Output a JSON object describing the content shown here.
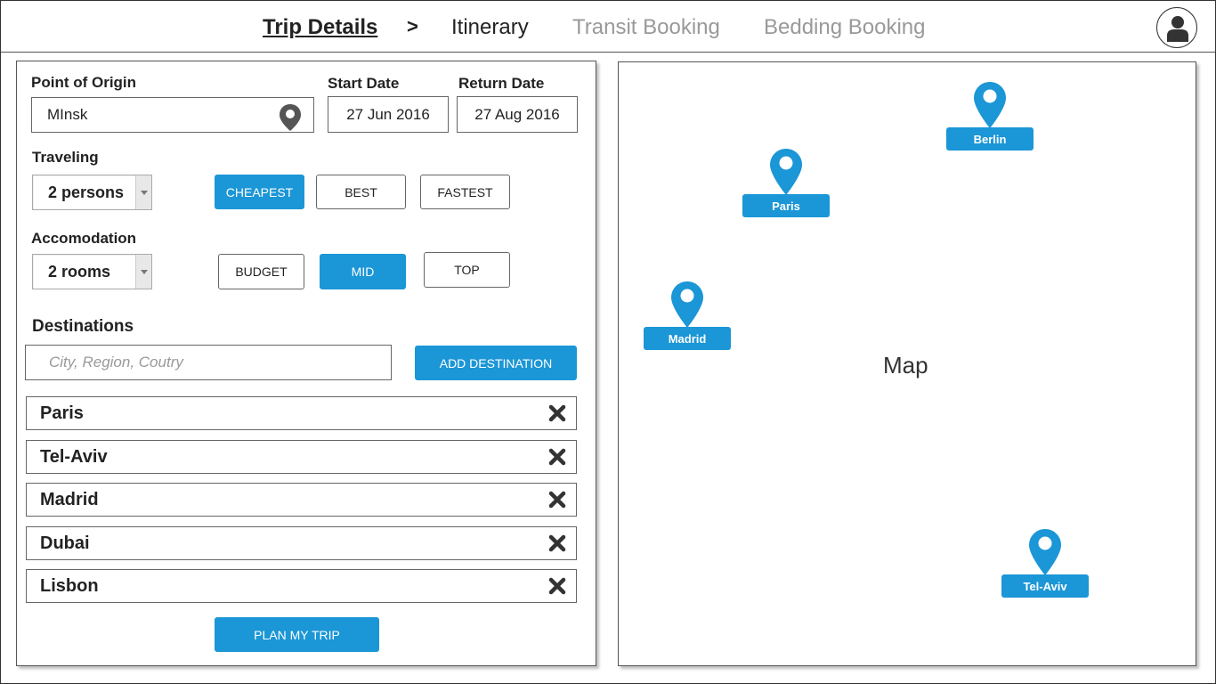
{
  "header": {
    "steps": [
      {
        "label": "Trip Details",
        "state": "active"
      },
      {
        "label": "Itinerary",
        "state": "next"
      },
      {
        "label": "Transit Booking",
        "state": "disabled"
      },
      {
        "label": "Bedding Booking",
        "state": "disabled"
      }
    ],
    "separator": ">",
    "avatar_icon": "user-icon"
  },
  "form": {
    "origin": {
      "label": "Point of Origin",
      "value": "MInsk",
      "icon": "location-pin-icon"
    },
    "start_date": {
      "label": "Start Date",
      "value": "27 Jun 2016"
    },
    "return_date": {
      "label": "Return Date",
      "value": "27 Aug 2016"
    },
    "traveling": {
      "label": "Traveling",
      "selected": "2 persons",
      "options": [
        "CHEAPEST",
        "BEST",
        "FASTEST"
      ],
      "active_option": "CHEAPEST"
    },
    "accommodation": {
      "label": "Accomodation",
      "selected": "2 rooms",
      "options": [
        "BUDGET",
        "MID",
        "TOP"
      ],
      "active_option": "MID"
    },
    "destinations": {
      "label": "Destinations",
      "placeholder": "City, Region, Coutry",
      "add_button": "ADD DESTINATION",
      "items": [
        "Paris",
        "Tel-Aviv",
        "Madrid",
        "Dubai",
        "Lisbon"
      ],
      "remove_icon": "close-x-icon"
    },
    "submit_button": "PLAN MY TRIP"
  },
  "map": {
    "title": "Map",
    "markers": [
      "Berlin",
      "Paris",
      "Madrid",
      "Tel-Aviv"
    ]
  },
  "colors": {
    "accent": "#1b96d6",
    "text": "#222222",
    "muted": "#999999"
  }
}
